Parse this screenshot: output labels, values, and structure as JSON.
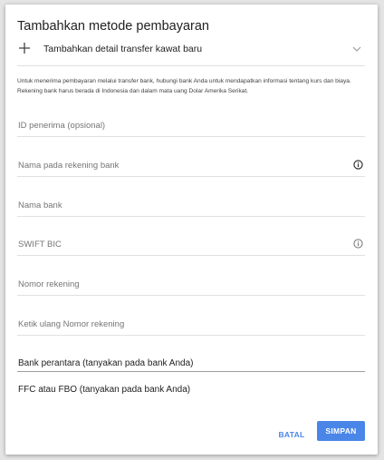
{
  "dialog": {
    "title": "Tambahkan metode pembayaran",
    "method": {
      "label": "Tambahkan detail transfer kawat baru",
      "plus_icon": "plus-icon",
      "chevron_icon": "chevron-down-icon"
    },
    "info_text": "Untuk menerima pembayaran melalui transfer bank, hubungi bank Anda untuk mendapatkan informasi tentang kurs dan biaya. Rekening bank harus berada di Indonesia dan dalam mata uang Dolar Amerika Serikat.",
    "fields": [
      {
        "label": "ID penerima (opsional)",
        "icon": ""
      },
      {
        "label": "Nama pada rekening bank",
        "icon": "info-icon"
      },
      {
        "label": "Nama bank",
        "icon": ""
      },
      {
        "label": "SWIFT BIC",
        "icon": "info-icon"
      },
      {
        "label": "Nomor rekening",
        "icon": ""
      },
      {
        "label": "Ketik ulang Nomor rekening",
        "icon": ""
      }
    ],
    "sections": {
      "intermediary": "Bank perantara (tanyakan pada bank Anda)",
      "ffc": "FFC atau FBO (tanyakan pada bank Anda)"
    },
    "buttons": {
      "cancel": "BATAL",
      "save": "SIMPAN"
    },
    "colors": {
      "accent": "#4a86e8",
      "divider": "#e0e0e0",
      "placeholder": "#757575"
    }
  }
}
